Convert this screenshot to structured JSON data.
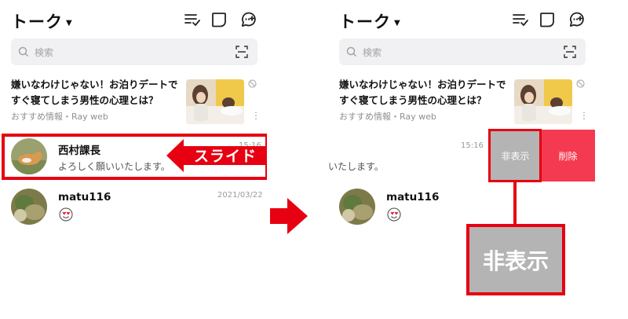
{
  "header": {
    "title": "トーク"
  },
  "search": {
    "placeholder": "検索"
  },
  "ad": {
    "line1": "嫌いなわけじゃない！お泊りデートで",
    "line2": "すぐ寝てしまう男性の心理とは？",
    "source": "おすすめ情報・Ray web"
  },
  "chats": [
    {
      "name": "西村課長",
      "message": "よろしく願いいたします。",
      "time": "15:16",
      "partial_message": "いたします。"
    },
    {
      "name": "matu116",
      "time": "2021/03/22",
      "sticker": "heart-eyes-emoji"
    }
  ],
  "annotation": {
    "slide": "スライド",
    "hide_callout": "非表示"
  },
  "actions": {
    "hide": "非表示",
    "delete": "削除"
  },
  "colors": {
    "accent_red": "#e60012",
    "delete_red": "#f33a50",
    "hide_gray": "#b4b4b4"
  }
}
